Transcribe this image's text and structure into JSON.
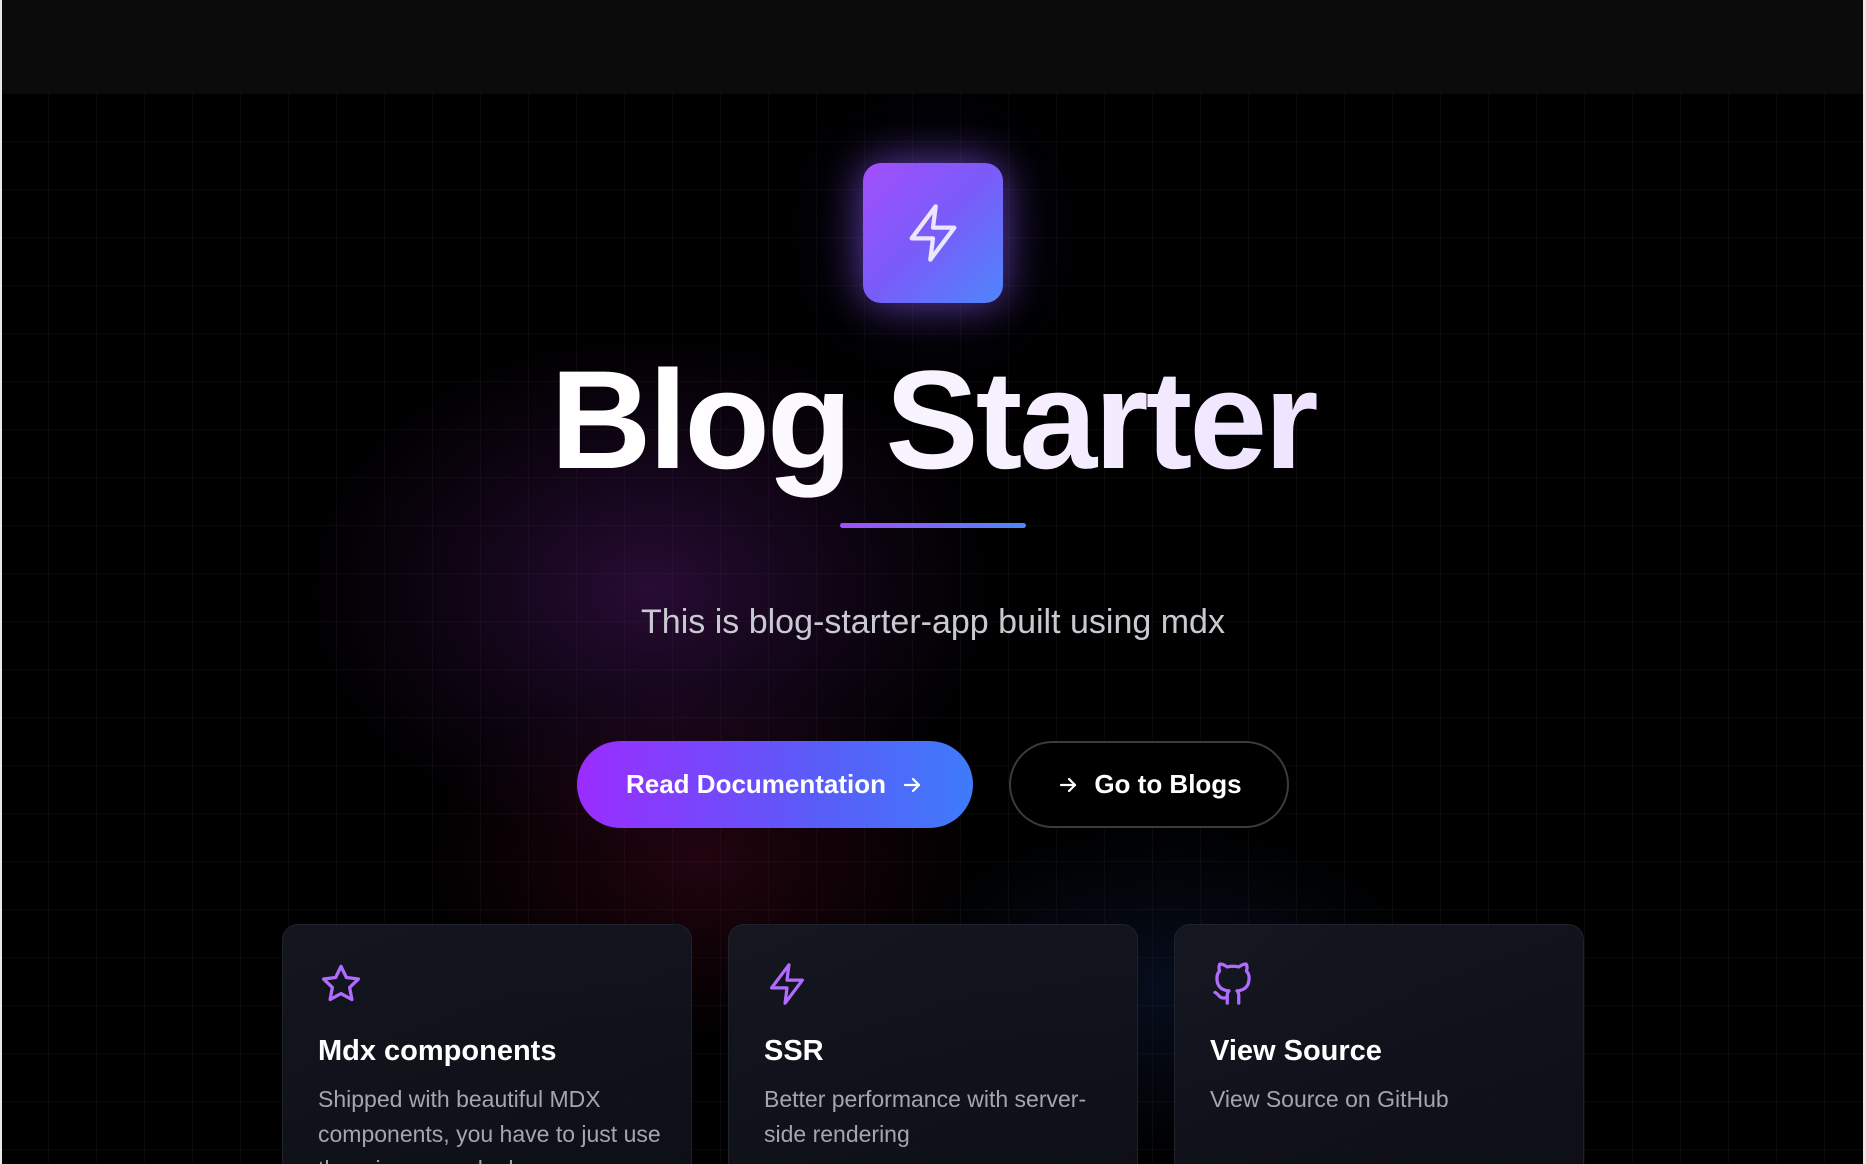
{
  "hero": {
    "logo_icon": "lightning-bolt-icon",
    "title": "Blog Starter",
    "subtitle": "This is blog-starter-app built using mdx"
  },
  "actions": {
    "primary": {
      "label": "Read Documentation",
      "icon": "arrow-right-icon"
    },
    "secondary": {
      "label": "Go to Blogs",
      "icon": "arrow-right-icon"
    }
  },
  "features": [
    {
      "icon": "star-icon",
      "title": "Mdx components",
      "description": "Shipped with beautiful MDX components, you have to just use them in your mdx doc"
    },
    {
      "icon": "lightning-bolt-icon",
      "title": "SSR",
      "description": "Better performance with server-side rendering"
    },
    {
      "icon": "github-icon",
      "title": "View Source",
      "description": "View Source on GitHub"
    }
  ],
  "colors": {
    "accent_purple": "#a24ffb",
    "accent_blue": "#4e86fb",
    "background": "#000000",
    "topbar": "#0b0b0c",
    "card_border": "#1f222c",
    "muted_text": "#a3a6b0"
  }
}
